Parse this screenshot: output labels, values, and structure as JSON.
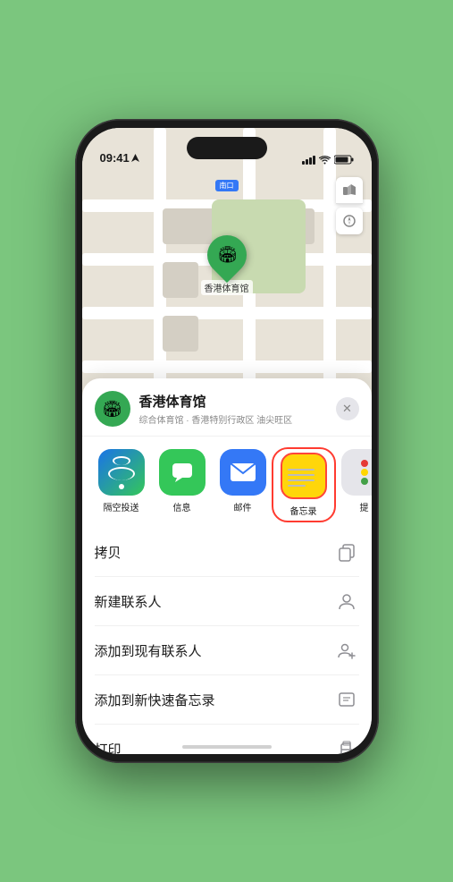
{
  "status_bar": {
    "time": "09:41",
    "location_icon": "▶"
  },
  "map": {
    "label": "南口",
    "pin_label": "香港体育馆"
  },
  "venue": {
    "name": "香港体育馆",
    "subtitle": "综合体育馆 · 香港特别行政区 油尖旺区"
  },
  "actions": [
    {
      "id": "airdrop",
      "label": "隔空投送",
      "type": "airdrop"
    },
    {
      "id": "message",
      "label": "信息",
      "type": "message"
    },
    {
      "id": "mail",
      "label": "邮件",
      "type": "mail"
    },
    {
      "id": "notes",
      "label": "备忘录",
      "type": "notes"
    },
    {
      "id": "more",
      "label": "提",
      "type": "more"
    }
  ],
  "menu_items": [
    {
      "id": "copy",
      "label": "拷贝",
      "icon": "copy"
    },
    {
      "id": "new-contact",
      "label": "新建联系人",
      "icon": "person"
    },
    {
      "id": "add-contact",
      "label": "添加到现有联系人",
      "icon": "person-add"
    },
    {
      "id": "quick-note",
      "label": "添加到新快速备忘录",
      "icon": "note"
    },
    {
      "id": "print",
      "label": "打印",
      "icon": "print"
    }
  ]
}
